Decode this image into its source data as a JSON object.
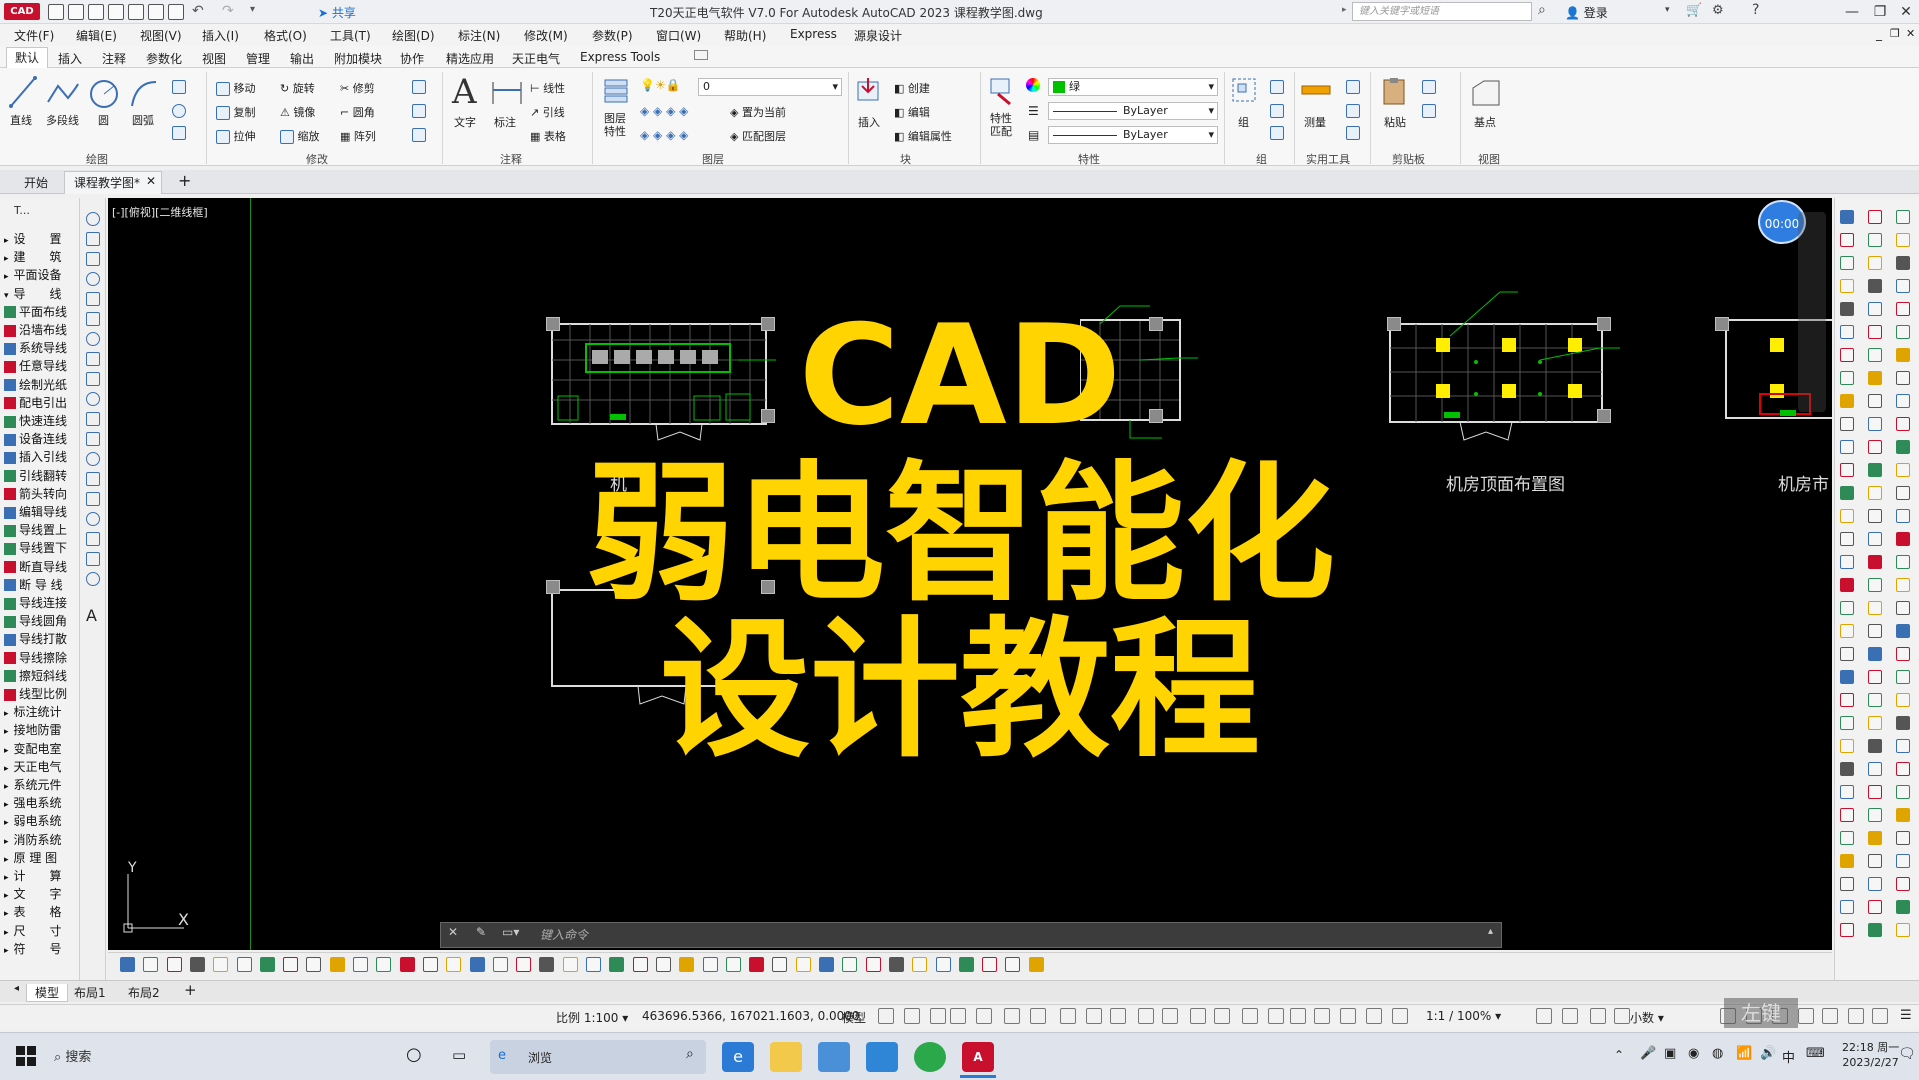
{
  "titlebar": {
    "app_badge": "CAD",
    "share": "共享",
    "title": "T20天正电气软件 V7.0 For Autodesk AutoCAD 2023    课程教学图.dwg",
    "search_placeholder": "键入关键字或短语",
    "login": "登录"
  },
  "menu": [
    "文件(F)",
    "编辑(E)",
    "视图(V)",
    "插入(I)",
    "格式(O)",
    "工具(T)",
    "绘图(D)",
    "标注(N)",
    "修改(M)",
    "参数(P)",
    "窗口(W)",
    "帮助(H)",
    "Express",
    "源泉设计"
  ],
  "ribbon_tabs": [
    "默认",
    "插入",
    "注释",
    "参数化",
    "视图",
    "管理",
    "输出",
    "附加模块",
    "协作",
    "精选应用",
    "天正电气",
    "Express Tools"
  ],
  "ribbon": {
    "draw": {
      "title": "绘图",
      "line": "直线",
      "polyline": "多段线",
      "circle": "圆",
      "arc": "圆弧"
    },
    "modify": {
      "title": "修改",
      "move": "移动",
      "rotate": "旋转",
      "trim": "修剪",
      "copy": "复制",
      "mirror": "镜像",
      "fillet": "圆角",
      "stretch": "拉伸",
      "scale": "缩放",
      "array": "阵列"
    },
    "annotation": {
      "title": "注释",
      "text": "文字",
      "dim": "标注",
      "linear": "线性",
      "leader": "引线",
      "table": "表格"
    },
    "layers": {
      "title": "图层",
      "props": "图层\n特性",
      "layer_value": "0",
      "set_current": "置为当前",
      "match": "匹配图层"
    },
    "block": {
      "title": "块",
      "insert": "插入",
      "create": "创建",
      "edit": "编辑",
      "edit_attr": "编辑属性"
    },
    "properties": {
      "title": "特性",
      "match": "特性\n匹配",
      "color": "绿",
      "linetype": "ByLayer",
      "lineweight": "ByLayer"
    },
    "groups": {
      "title": "组",
      "group": "组"
    },
    "utilities": {
      "title": "实用工具",
      "measure": "测量"
    },
    "clipboard": {
      "title": "剪贴板",
      "paste": "粘贴"
    },
    "view": {
      "title": "视图",
      "base": "基点"
    }
  },
  "doctabs": {
    "start": "开始",
    "active": "课程教学图*"
  },
  "left_palette": {
    "header": "T...",
    "items": [
      "设　　置",
      "建　　筑",
      "平面设备",
      "导　　线",
      "平面布线",
      "沿墙布线",
      "系统导线",
      "任意导线",
      "绘制光纸",
      "配电引出",
      "快速连线",
      "设备连线",
      "插入引线",
      "引线翻转",
      "箭头转向",
      "编辑导线",
      "导线置上",
      "导线置下",
      "断直导线",
      "断 导 线",
      "导线连接",
      "导线圆角",
      "导线打散",
      "导线擦除",
      "擦短斜线",
      "线型比例",
      "标注统计",
      "接地防雷",
      "变配电室",
      "天正电气",
      "系统元件",
      "强电系统",
      "弱电系统",
      "消防系统",
      "原 理 图",
      "计　　算",
      "文　　字",
      "表　　格",
      "尺　　寸",
      "符　　号"
    ]
  },
  "canvas": {
    "viewport_label": "[-][俯视][二维线框]",
    "timer": "00:00",
    "plan_titles": [
      "机",
      "机房顶面布置图",
      "机房市"
    ],
    "overlay_line1": "CAD",
    "overlay_line2": "弱电智能化",
    "overlay_line3": "设计教程",
    "ucs_x": "X",
    "ucs_y": "Y"
  },
  "cmdline": {
    "placeholder": "键入命令"
  },
  "layout_tabs": [
    "模型",
    "布局1",
    "布局2"
  ],
  "status": {
    "scale": "比例 1:100",
    "coords": "463696.5366, 167021.1603, 0.0000",
    "model": "模型",
    "anno_scale": "1:1 / 100%",
    "units": "小数"
  },
  "taskbar": {
    "search": "搜索",
    "app_label": "浏览",
    "time": "22:18 周一",
    "date": "2023/2/27",
    "ime": "中"
  },
  "watermark": "左键",
  "colors": {
    "accent_yellow": "#ffd400",
    "canvas_bg": "#000000",
    "autocad_red": "#c8102e",
    "cad_green": "#00c000"
  }
}
